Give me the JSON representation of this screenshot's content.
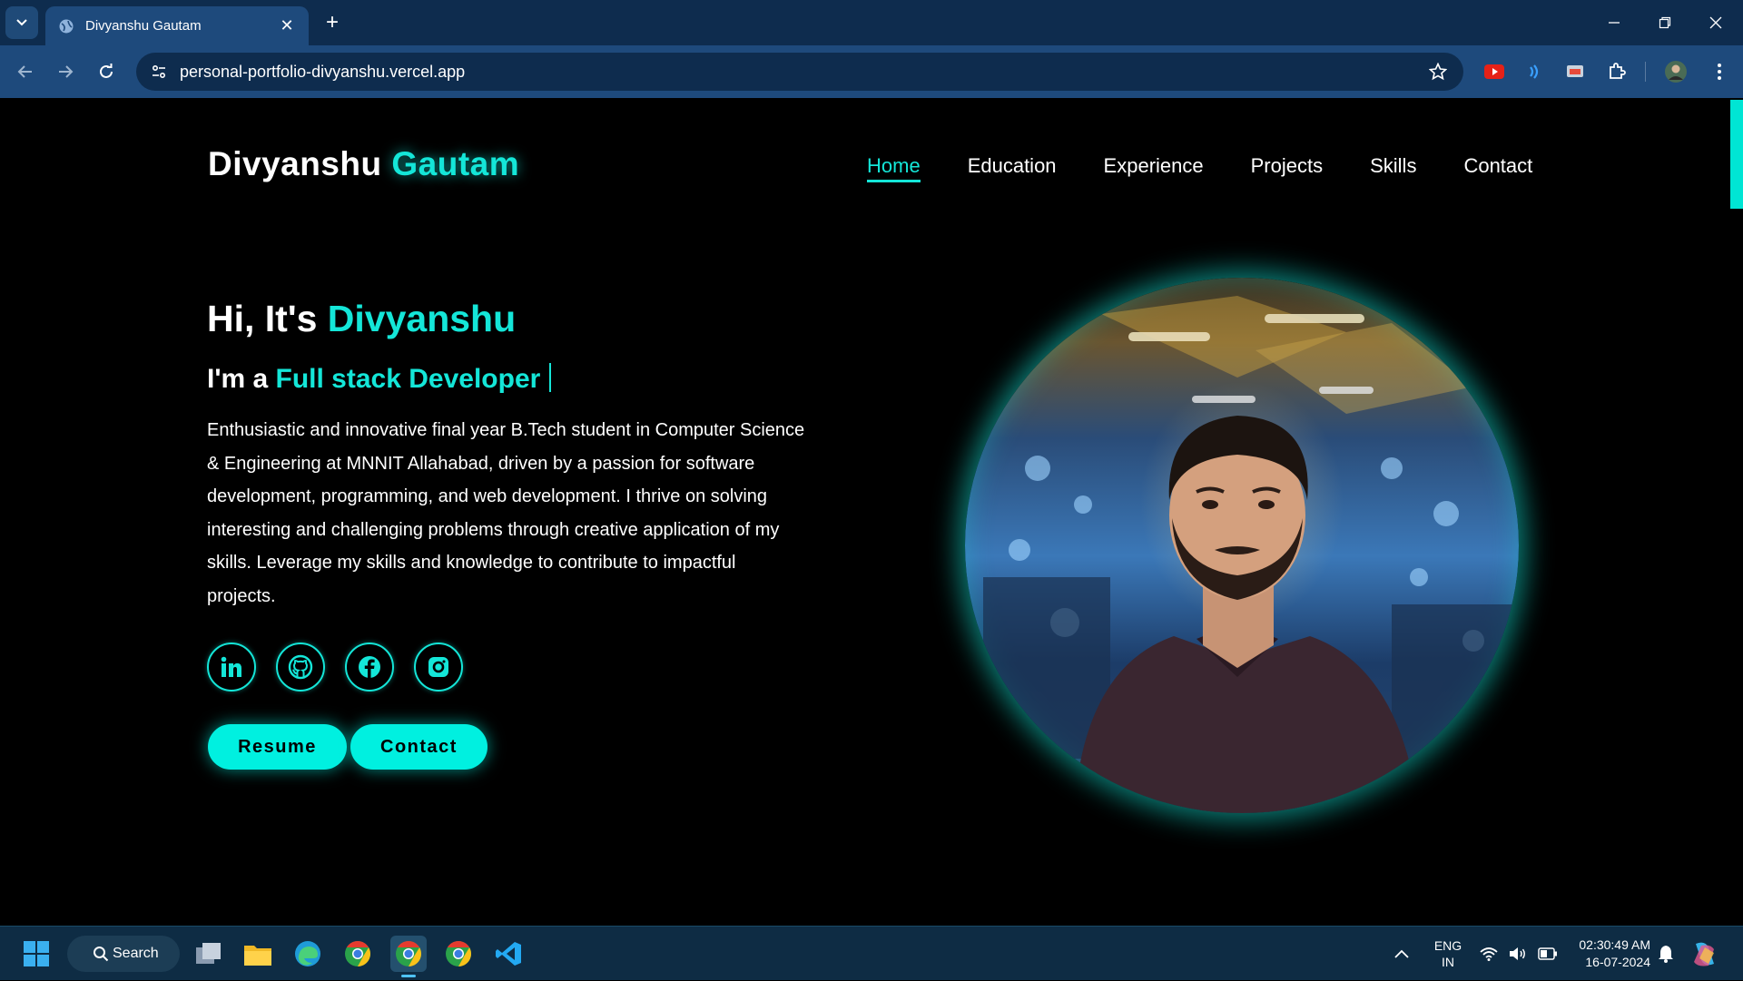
{
  "browser": {
    "tab_title": "Divyanshu Gautam",
    "url": "personal-portfolio-divyanshu.vercel.app"
  },
  "site": {
    "logo_first": "Divyanshu",
    "logo_last": "Gautam",
    "nav": [
      "Home",
      "Education",
      "Experience",
      "Projects",
      "Skills",
      "Contact"
    ],
    "active_nav": "Home"
  },
  "hero": {
    "greeting": "Hi, It's",
    "name": "Divyanshu",
    "role_prefix": "I'm a",
    "role": "Full stack Developer",
    "bio": "Enthusiastic and innovative final year B.Tech student in Computer Science & Engineering at MNNIT Allahabad, driven by a passion for software development, programming, and web development. I thrive on solving interesting and challenging problems through creative application of my skills. Leverage my skills and knowledge to contribute to impactful projects.",
    "socials": [
      "linkedin-icon",
      "github-icon",
      "facebook-icon",
      "instagram-icon"
    ],
    "buttons": {
      "resume": "Resume",
      "contact": "Contact"
    }
  },
  "taskbar": {
    "search_label": "Search",
    "lang_top": "ENG",
    "lang_bottom": "IN",
    "time": "02:30:49 AM",
    "date": "16-07-2024"
  },
  "colors": {
    "accent": "#14e6d8",
    "chrome": "#1e4a7c",
    "tabstrip": "#0e2c4e",
    "page_bg": "#000000"
  }
}
